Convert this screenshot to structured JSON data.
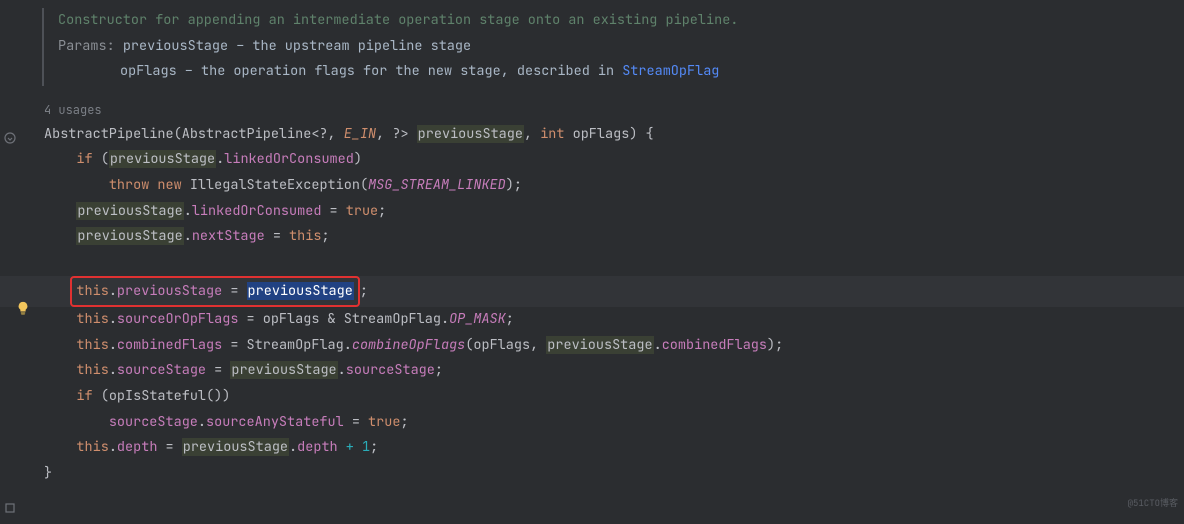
{
  "doc": {
    "summary": "Constructor for appending an intermediate operation stage onto an existing pipeline.",
    "params_label": "Params:",
    "p1": "previousStage – the upstream pipeline stage",
    "p2_pre": "opFlags – the operation flags for the new stage, described in ",
    "p2_link": "StreamOpFlag"
  },
  "usages": "4 usages",
  "code": {
    "sig_name": "AbstractPipeline",
    "sig_type": "AbstractPipeline",
    "sig_gen_open": "<?,",
    "sig_gen_ein": "E_IN",
    "sig_gen_close": ", ?>",
    "sig_param1": "previousStage",
    "sig_int": "int",
    "sig_param2": "opFlags",
    "sig_brace": ") {",
    "if": "if",
    "prev": "previousStage",
    "linkedOrConsumed": "linkedOrConsumed",
    "throw": "throw",
    "new": "new",
    "ise": "IllegalStateException",
    "msg": "MSG_STREAM_LINKED",
    "assign_true": " = ",
    "true": "true",
    "nextStage": "nextStage",
    "this": "this",
    "previous_field": "previousStage",
    "sourceOrOpFlags": "sourceOrOpFlags",
    "opFlags": "opFlags",
    "amp": " & ",
    "StreamOpFlag": "StreamOpFlag",
    "OP_MASK": "OP_MASK",
    "combinedFlags": "combinedFlags",
    "combineOpFlags": "combineOpFlags",
    "sourceStage": "sourceStage",
    "opIsStateful": "opIsStateful",
    "sourceAnyStateful": "sourceAnyStateful",
    "depth": "depth",
    "plus1": " + 1",
    "semi": ";",
    "close_brace": "}"
  },
  "watermark": "@51CTO博客"
}
